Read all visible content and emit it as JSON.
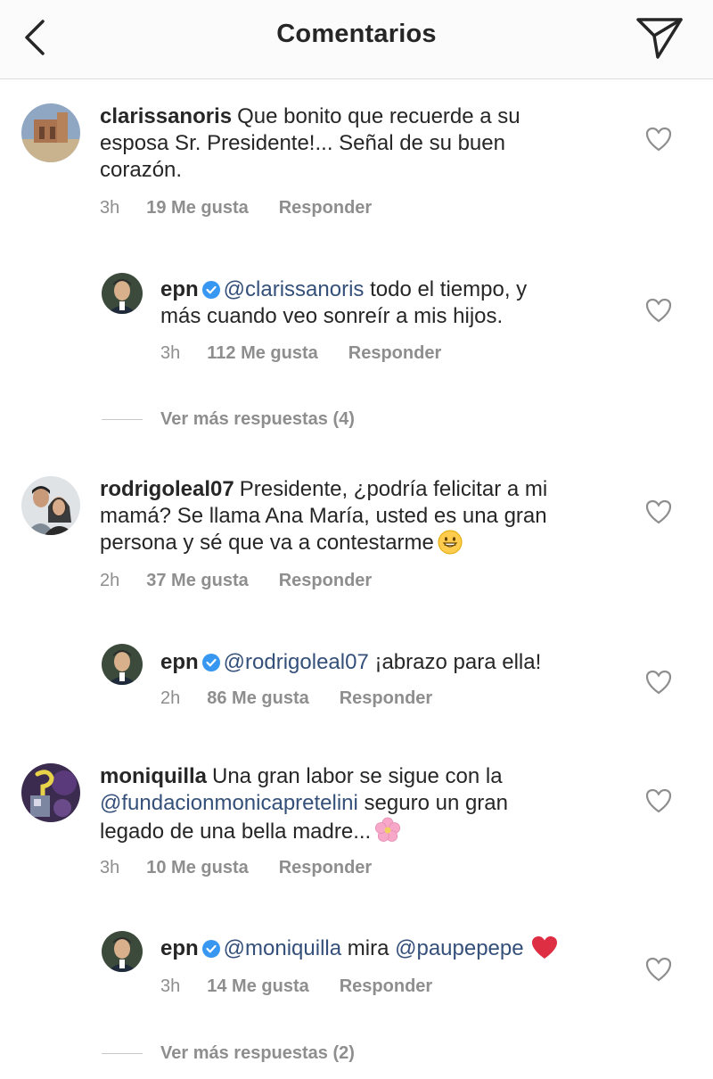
{
  "header": {
    "title": "Comentarios",
    "back_icon": "chevron-left-icon",
    "send_icon": "paper-plane-icon"
  },
  "colors": {
    "mention": "#34507a",
    "verified": "#3897f0",
    "meta_gray": "#8e8e8e",
    "heart_gray": "#8e8e8e"
  },
  "comments": [
    {
      "username": "clarissanoris",
      "text": "Que bonito que recuerde a su",
      "text_line2": "esposa Sr. Presidente!... Señal de su buen",
      "text_line3": "corazón.",
      "time": "3h",
      "likes": "19 Me gusta",
      "reply": "Responder"
    },
    {
      "username": "epn",
      "mention": "@clarissanoris",
      "text": "todo el tiempo, y",
      "text_line2": "más cuando veo sonreír a mis hijos.",
      "time": "3h",
      "likes": "112 Me gusta",
      "reply": "Responder"
    },
    {
      "more_replies": "Ver más respuestas (4)"
    },
    {
      "username": "rodrigoleal07",
      "text": "Presidente, ¿podría felicitar a mi",
      "text_line2": "mamá? Se llama Ana María, usted es una gran",
      "text_line3": "persona y sé que va a contestarme",
      "emoji": "grinning-face-emoji",
      "time": "2h",
      "likes": "37 Me gusta",
      "reply": "Responder"
    },
    {
      "username": "epn",
      "mention": "@rodrigoleal07",
      "text": "¡abrazo para ella!",
      "time": "2h",
      "likes": "86 Me gusta",
      "reply": "Responder"
    },
    {
      "username": "moniquilla",
      "text": "Una gran labor se sigue con la",
      "mention": "@fundacionmonicapretelini",
      "text_line2": "seguro un gran",
      "text_line3": "legado  de una bella madre...",
      "emoji": "cherry-blossom-emoji",
      "time": "3h",
      "likes": "10 Me gusta",
      "reply": "Responder"
    },
    {
      "username": "epn",
      "mention": "@moniquilla",
      "text": "mira",
      "mention2": "@paupepepe",
      "emoji": "red-heart-emoji",
      "time": "3h",
      "likes": "14 Me gusta",
      "reply": "Responder"
    },
    {
      "more_replies": "Ver más respuestas (2)"
    }
  ]
}
